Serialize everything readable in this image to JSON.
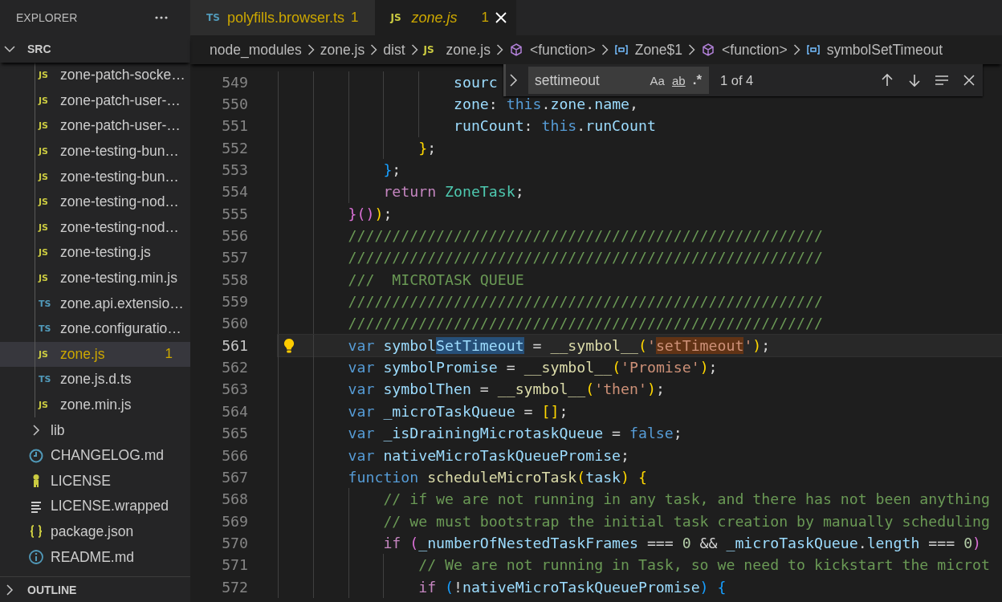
{
  "sidebar": {
    "title": "EXPLORER",
    "section": {
      "label": "SRC",
      "expanded": true
    },
    "tree": {
      "nested_items": [
        {
          "kind": "js",
          "icon_text": "JS",
          "label": "zone-patch-socke…",
          "selected": false,
          "warning": false
        },
        {
          "kind": "js",
          "icon_text": "JS",
          "label": "zone-patch-user-…",
          "selected": false,
          "warning": false
        },
        {
          "kind": "js",
          "icon_text": "JS",
          "label": "zone-patch-user-…",
          "selected": false,
          "warning": false
        },
        {
          "kind": "js",
          "icon_text": "JS",
          "label": "zone-testing-bun…",
          "selected": false,
          "warning": false
        },
        {
          "kind": "js",
          "icon_text": "JS",
          "label": "zone-testing-bun…",
          "selected": false,
          "warning": false
        },
        {
          "kind": "js",
          "icon_text": "JS",
          "label": "zone-testing-nod…",
          "selected": false,
          "warning": false
        },
        {
          "kind": "js",
          "icon_text": "JS",
          "label": "zone-testing-nod…",
          "selected": false,
          "warning": false
        },
        {
          "kind": "js",
          "icon_text": "JS",
          "label": "zone-testing.js",
          "selected": false,
          "warning": false
        },
        {
          "kind": "js",
          "icon_text": "JS",
          "label": "zone-testing.min.js",
          "selected": false,
          "warning": false
        },
        {
          "kind": "ts",
          "icon_text": "TS",
          "label": "zone.api.extensio…",
          "selected": false,
          "warning": false
        },
        {
          "kind": "ts",
          "icon_text": "TS",
          "label": "zone.configuratio…",
          "selected": false,
          "warning": false
        },
        {
          "kind": "js",
          "icon_text": "JS",
          "label": "zone.js",
          "badge": "1",
          "selected": true,
          "warning": true
        },
        {
          "kind": "ts",
          "icon_text": "TS",
          "label": "zone.js.d.ts",
          "selected": false,
          "warning": false
        },
        {
          "kind": "js",
          "icon_text": "JS",
          "label": "zone.min.js",
          "selected": false,
          "warning": false
        }
      ],
      "items": [
        {
          "kind": "folder",
          "label": "lib",
          "expanded": false,
          "selected": false
        },
        {
          "kind": "changelog",
          "label": "CHANGELOG.md",
          "selected": false
        },
        {
          "kind": "license",
          "label": "LICENSE",
          "selected": false
        },
        {
          "kind": "text",
          "label": "LICENSE.wrapped",
          "selected": false
        },
        {
          "kind": "json",
          "label": "package.json",
          "selected": false
        },
        {
          "kind": "readme",
          "label": "README.md",
          "selected": false
        }
      ]
    },
    "outline": {
      "label": "OUTLINE",
      "expanded": false
    }
  },
  "tabs": [
    {
      "kind": "ts",
      "icon_text": "TS",
      "label": "polyfills.browser.ts",
      "badge": "1",
      "warning": true,
      "preview": false,
      "selected": false,
      "closable": false
    },
    {
      "kind": "js",
      "icon_text": "JS",
      "label": "zone.js",
      "badge": "1",
      "warning": true,
      "preview": true,
      "selected": true,
      "closable": true
    }
  ],
  "breadcrumbs": [
    {
      "kind": "folder",
      "label": "node_modules"
    },
    {
      "kind": "folder",
      "label": "zone.js"
    },
    {
      "kind": "folder",
      "label": "dist"
    },
    {
      "kind": "file",
      "icon_text": "JS",
      "label": "zone.js"
    },
    {
      "kind": "module",
      "label": "<function>"
    },
    {
      "kind": "variable",
      "label": "Zone$1"
    },
    {
      "kind": "module",
      "label": "<function>"
    },
    {
      "kind": "variable",
      "label": "symbolSetTimeout"
    }
  ],
  "find": {
    "replace_expanded": false,
    "value": "settimeout",
    "options": [
      {
        "kind": "case",
        "label": "Aa",
        "on": false
      },
      {
        "kind": "word",
        "label": "ab",
        "on": false
      },
      {
        "kind": "regex",
        "label": ".*",
        "on": false
      }
    ],
    "count": "1 of 4"
  },
  "editor": {
    "lines": [
      {
        "children": [
          {
            "children": [
              {
                "children": [
                  {
                    "children": [
                      {
                        "children": [
                          {
                            "number": "549",
                            "current": false,
                            "lightbulb": false,
                            "tokens": [
                              {
                                "text": "sourc",
                                "kind": "var"
                              }
                            ]
                          },
                          {
                            "number": "550",
                            "current": false,
                            "lightbulb": false,
                            "tokens": [
                              {
                                "text": "zone",
                                "kind": "var"
                              },
                              {
                                "text": ": ",
                                "kind": "p"
                              },
                              {
                                "text": "this",
                                "kind": "kw"
                              },
                              {
                                "text": ".",
                                "kind": "p"
                              },
                              {
                                "text": "zone",
                                "kind": "var"
                              },
                              {
                                "text": ".",
                                "kind": "p"
                              },
                              {
                                "text": "name",
                                "kind": "var"
                              },
                              {
                                "text": ",",
                                "kind": "p"
                              }
                            ]
                          },
                          {
                            "number": "551",
                            "current": false,
                            "lightbulb": false,
                            "tokens": [
                              {
                                "text": "runCount",
                                "kind": "var"
                              },
                              {
                                "text": ": ",
                                "kind": "p"
                              },
                              {
                                "text": "this",
                                "kind": "kw"
                              },
                              {
                                "text": ".",
                                "kind": "p"
                              },
                              {
                                "text": "runCount",
                                "kind": "var"
                              }
                            ]
                          }
                        ]
                      },
                      {
                        "number": "552",
                        "current": false,
                        "lightbulb": false,
                        "tokens": [
                          {
                            "text": "}",
                            "kind": "b1"
                          },
                          {
                            "text": ";",
                            "kind": "p"
                          }
                        ]
                      }
                    ]
                  },
                  {
                    "number": "553",
                    "current": false,
                    "lightbulb": false,
                    "tokens": [
                      {
                        "text": "}",
                        "kind": "b3"
                      },
                      {
                        "text": ";",
                        "kind": "p"
                      }
                    ]
                  },
                  {
                    "number": "554",
                    "current": false,
                    "lightbulb": false,
                    "tokens": [
                      {
                        "text": "return",
                        "kind": "ctl"
                      },
                      {
                        "text": " ZoneTask",
                        "kind": "type"
                      },
                      {
                        "text": ";",
                        "kind": "p"
                      }
                    ]
                  }
                ]
              },
              {
                "number": "555",
                "current": false,
                "lightbulb": false,
                "tokens": [
                  {
                    "text": "}()",
                    "kind": "b2"
                  },
                  {
                    "text": ")",
                    "kind": "b1"
                  },
                  {
                    "text": ";",
                    "kind": "p"
                  }
                ]
              },
              {
                "number": "556",
                "current": false,
                "lightbulb": false,
                "tokens": [
                  {
                    "text": "//////////////////////////////////////////////////////",
                    "kind": "com"
                  }
                ]
              },
              {
                "number": "557",
                "current": false,
                "lightbulb": false,
                "tokens": [
                  {
                    "text": "//////////////////////////////////////////////////////",
                    "kind": "com"
                  }
                ]
              },
              {
                "number": "558",
                "current": false,
                "lightbulb": false,
                "tokens": [
                  {
                    "text": "///  MICROTASK QUEUE",
                    "kind": "com"
                  }
                ]
              },
              {
                "number": "559",
                "current": false,
                "lightbulb": false,
                "tokens": [
                  {
                    "text": "//////////////////////////////////////////////////////",
                    "kind": "com"
                  }
                ]
              },
              {
                "number": "560",
                "current": false,
                "lightbulb": false,
                "tokens": [
                  {
                    "text": "//////////////////////////////////////////////////////",
                    "kind": "com"
                  }
                ]
              },
              {
                "number": "561",
                "current": true,
                "lightbulb": true,
                "tokens": [
                  {
                    "text": "var",
                    "kind": "kw"
                  },
                  {
                    "text": " symbol",
                    "kind": "var"
                  },
                  {
                    "text": "SetTimeout",
                    "kind": "var",
                    "selected": true
                  },
                  {
                    "text": " = ",
                    "kind": "p"
                  },
                  {
                    "text": "__symbol__",
                    "kind": "fn"
                  },
                  {
                    "text": "(",
                    "kind": "b1"
                  },
                  {
                    "text": "'",
                    "kind": "str"
                  },
                  {
                    "text": "setTimeout",
                    "kind": "str",
                    "match": true
                  },
                  {
                    "text": "'",
                    "kind": "str"
                  },
                  {
                    "text": ")",
                    "kind": "b1"
                  },
                  {
                    "text": ";",
                    "kind": "p"
                  }
                ]
              },
              {
                "number": "562",
                "current": false,
                "lightbulb": false,
                "tokens": [
                  {
                    "text": "var",
                    "kind": "kw"
                  },
                  {
                    "text": " symbolPromise",
                    "kind": "var"
                  },
                  {
                    "text": " = ",
                    "kind": "p"
                  },
                  {
                    "text": "__symbol__",
                    "kind": "fn"
                  },
                  {
                    "text": "(",
                    "kind": "b1"
                  },
                  {
                    "text": "'Promise'",
                    "kind": "str"
                  },
                  {
                    "text": ")",
                    "kind": "b1"
                  },
                  {
                    "text": ";",
                    "kind": "p"
                  }
                ]
              },
              {
                "number": "563",
                "current": false,
                "lightbulb": false,
                "tokens": [
                  {
                    "text": "var",
                    "kind": "kw"
                  },
                  {
                    "text": " symbolThen",
                    "kind": "var"
                  },
                  {
                    "text": " = ",
                    "kind": "p"
                  },
                  {
                    "text": "__symbol__",
                    "kind": "fn"
                  },
                  {
                    "text": "(",
                    "kind": "b1"
                  },
                  {
                    "text": "'then'",
                    "kind": "str"
                  },
                  {
                    "text": ")",
                    "kind": "b1"
                  },
                  {
                    "text": ";",
                    "kind": "p"
                  }
                ]
              },
              {
                "number": "564",
                "current": false,
                "lightbulb": false,
                "tokens": [
                  {
                    "text": "var",
                    "kind": "kw"
                  },
                  {
                    "text": " _microTaskQueue",
                    "kind": "var"
                  },
                  {
                    "text": " = ",
                    "kind": "p"
                  },
                  {
                    "text": "[]",
                    "kind": "b1"
                  },
                  {
                    "text": ";",
                    "kind": "p"
                  }
                ]
              },
              {
                "number": "565",
                "current": false,
                "lightbulb": false,
                "tokens": [
                  {
                    "text": "var",
                    "kind": "kw"
                  },
                  {
                    "text": " _isDrainingMicrotaskQueue",
                    "kind": "var"
                  },
                  {
                    "text": " = ",
                    "kind": "p"
                  },
                  {
                    "text": "false",
                    "kind": "kw"
                  },
                  {
                    "text": ";",
                    "kind": "p"
                  }
                ]
              },
              {
                "number": "566",
                "current": false,
                "lightbulb": false,
                "tokens": [
                  {
                    "text": "var",
                    "kind": "kw"
                  },
                  {
                    "text": " nativeMicroTaskQueuePromise",
                    "kind": "var"
                  },
                  {
                    "text": ";",
                    "kind": "p"
                  }
                ]
              },
              {
                "number": "567",
                "current": false,
                "lightbulb": false,
                "tokens": [
                  {
                    "text": "function",
                    "kind": "kw"
                  },
                  {
                    "text": " scheduleMicroTask",
                    "kind": "fn"
                  },
                  {
                    "text": "(",
                    "kind": "b1"
                  },
                  {
                    "text": "task",
                    "kind": "var"
                  },
                  {
                    "text": ") {",
                    "kind": "b1"
                  }
                ],
                "children": [
                  {
                    "number": "568",
                    "current": false,
                    "lightbulb": false,
                    "tokens": [
                      {
                        "text": "// if we are not running in any task, and there has not been anything",
                        "kind": "com"
                      }
                    ]
                  },
                  {
                    "number": "569",
                    "current": false,
                    "lightbulb": false,
                    "tokens": [
                      {
                        "text": "// we must bootstrap the initial task creation by manually scheduling",
                        "kind": "com"
                      }
                    ]
                  },
                  {
                    "number": "570",
                    "current": false,
                    "lightbulb": false,
                    "tokens": [
                      {
                        "text": "if",
                        "kind": "ctl"
                      },
                      {
                        "text": " (",
                        "kind": "b2"
                      },
                      {
                        "text": "_numberOfNestedTaskFrames",
                        "kind": "var"
                      },
                      {
                        "text": " === ",
                        "kind": "p"
                      },
                      {
                        "text": "0",
                        "kind": "num"
                      },
                      {
                        "text": " && ",
                        "kind": "p"
                      },
                      {
                        "text": "_microTaskQueue",
                        "kind": "var"
                      },
                      {
                        "text": ".",
                        "kind": "p"
                      },
                      {
                        "text": "length",
                        "kind": "var"
                      },
                      {
                        "text": " === ",
                        "kind": "p"
                      },
                      {
                        "text": "0",
                        "kind": "num"
                      },
                      {
                        "text": ")",
                        "kind": "b2"
                      }
                    ],
                    "children": [
                      {
                        "number": "571",
                        "current": false,
                        "lightbulb": false,
                        "tokens": [
                          {
                            "text": "// We are not running in Task, so we need to kickstart the microt",
                            "kind": "com"
                          }
                        ]
                      },
                      {
                        "number": "572",
                        "current": false,
                        "lightbulb": false,
                        "tokens": [
                          {
                            "text": "if",
                            "kind": "ctl"
                          },
                          {
                            "text": " (",
                            "kind": "b3"
                          },
                          {
                            "text": "!",
                            "kind": "p"
                          },
                          {
                            "text": "nativeMicroTaskQueuePromise",
                            "kind": "var"
                          },
                          {
                            "text": ") {",
                            "kind": "b3"
                          }
                        ]
                      }
                    ]
                  }
                ]
              }
            ]
          }
        ]
      }
    ]
  }
}
